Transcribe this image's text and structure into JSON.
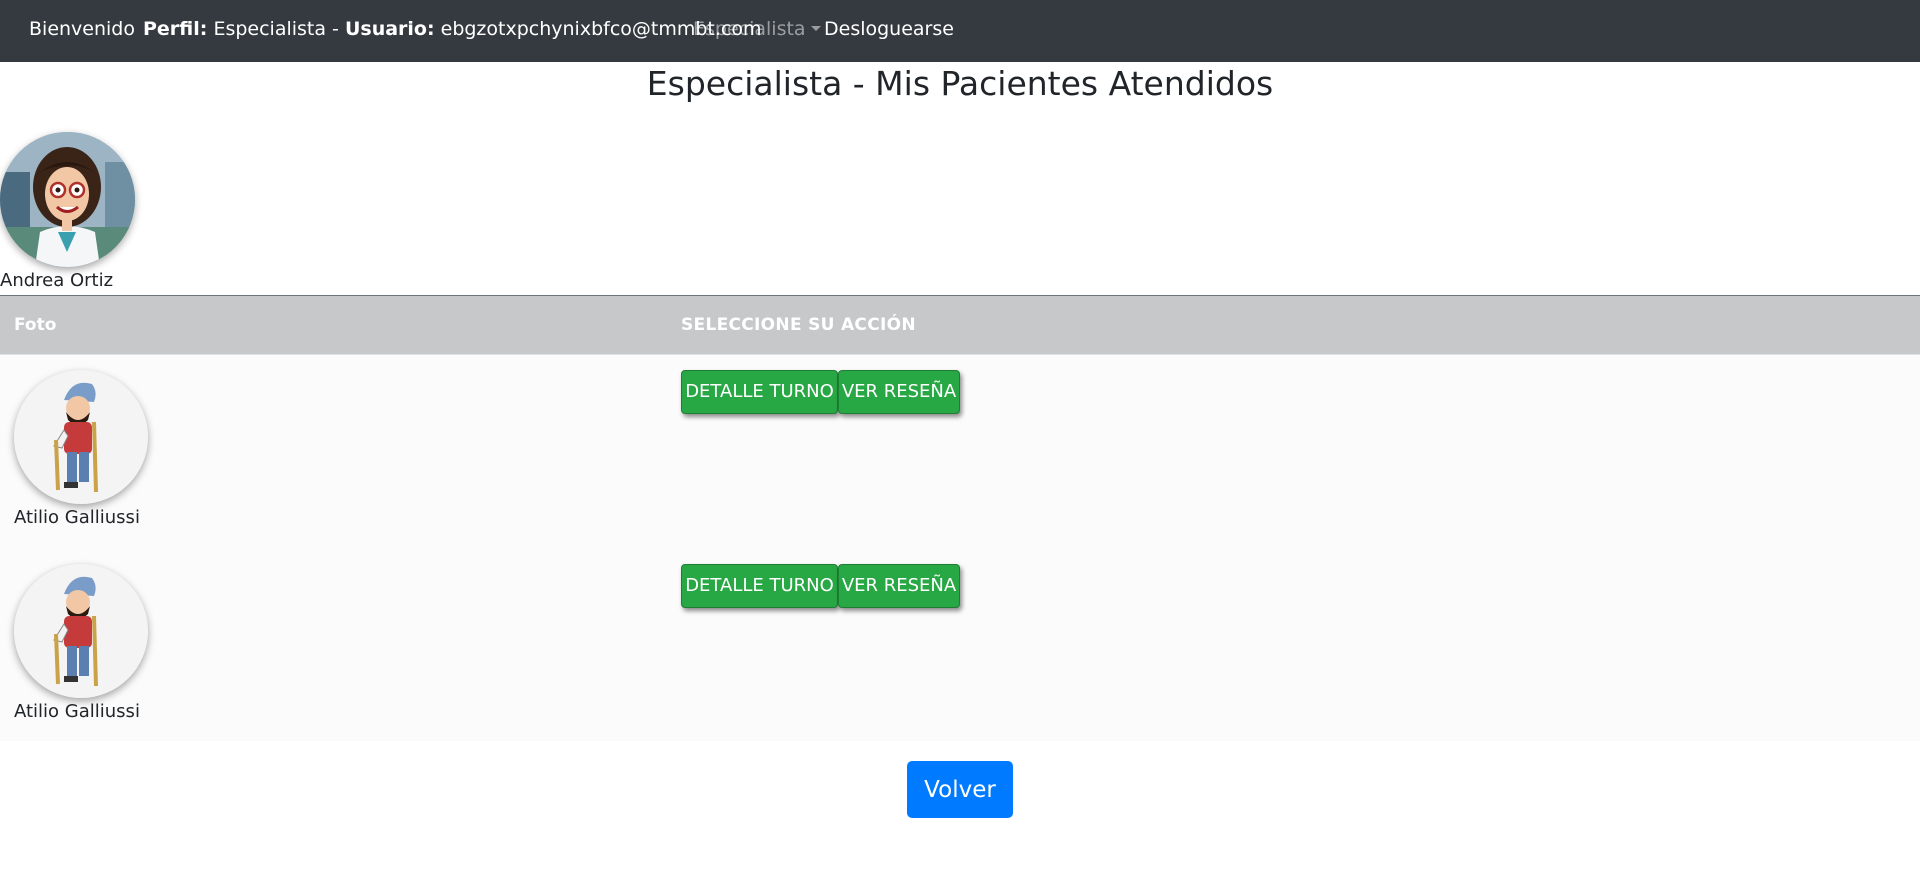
{
  "navbar": {
    "welcome": "Bienvenido",
    "profile_label": "Perfil:",
    "profile_value": "Especialista -",
    "user_label": "Usuario:",
    "user_value": "ebgzotxpchynixbfco@tmmbt.com",
    "menu_specialist": "Especialista",
    "logout": "Desloguearse"
  },
  "page": {
    "title": "Especialista - Mis Pacientes Atendidos"
  },
  "doctor": {
    "name": "Andrea Ortiz"
  },
  "table": {
    "headers": [
      "Foto",
      "SELECCIONE SU ACCIÓN"
    ],
    "rows": [
      {
        "name": "Atilio Galliussi",
        "btn_detail": "DETALLE TURNO",
        "btn_review": "VER RESEÑA"
      },
      {
        "name": "Atilio Galliussi",
        "btn_detail": "DETALLE TURNO",
        "btn_review": "VER RESEÑA"
      }
    ]
  },
  "footer": {
    "back_label": "Volver"
  },
  "colors": {
    "navbar_bg": "#343a40",
    "header_bg": "#c6c8ca",
    "success": "#28a745",
    "primary": "#007bff"
  }
}
